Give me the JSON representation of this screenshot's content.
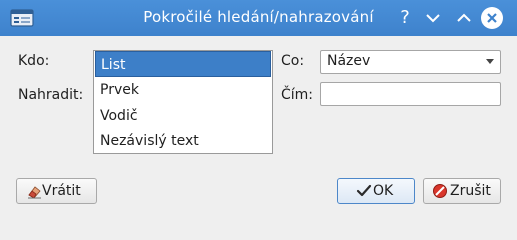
{
  "window": {
    "title": "Pokročilé hledání/nahrazování",
    "help_glyph": "?",
    "accent_color": "#4a90d9"
  },
  "form": {
    "kdo_label": "Kdo:",
    "nahradit_label": "Nahradit:",
    "co_label": "Co:",
    "cim_label": "Čím:",
    "kdo_options": [
      "List",
      "Prvek",
      "Vodič",
      "Nezávislý text"
    ],
    "kdo_selected": "List",
    "co_value": "Název",
    "cim_value": ""
  },
  "buttons": {
    "vratit_label": "Vrátit",
    "ok_label": "OK",
    "zrusit_label": "Zrušit"
  },
  "icons": {
    "app": "window-icon",
    "help": "help-icon",
    "minimize": "chevron-down-icon",
    "maximize": "chevron-up-icon",
    "close": "close-icon",
    "vratit": "eraser-icon",
    "ok": "checkmark-icon",
    "zrusit": "cancel-icon"
  }
}
